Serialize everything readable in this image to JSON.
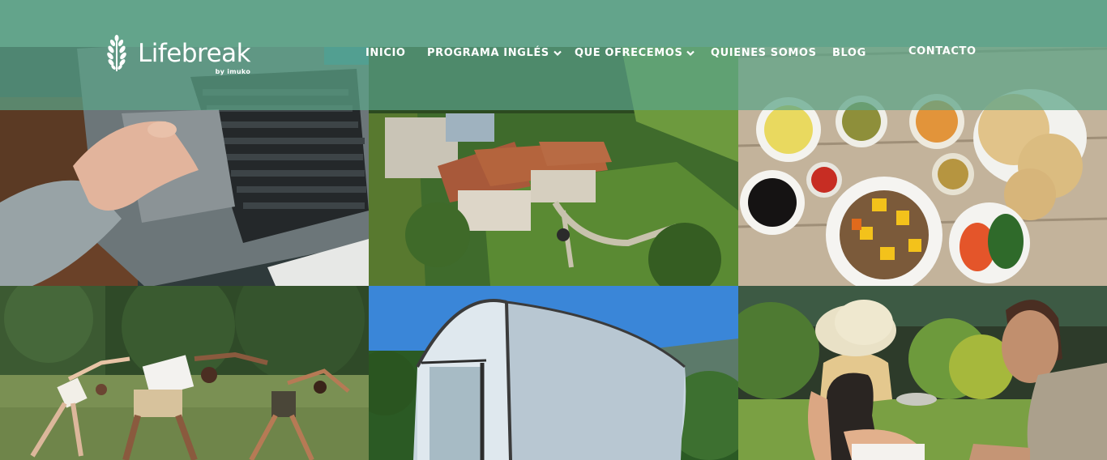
{
  "header": {
    "logo": {
      "word": "Lifebreak",
      "sub": "by imuko"
    },
    "nav": [
      {
        "label": "INICIO",
        "dropdown": false
      },
      {
        "label": "PROGRAMA INGLÉS",
        "dropdown": true
      },
      {
        "label": "QUE OFRECEMOS",
        "dropdown": true
      },
      {
        "label": "QUIENES SOMOS",
        "dropdown": false
      },
      {
        "label": "BLOG",
        "dropdown": false
      },
      {
        "label": "CONTACTO",
        "dropdown": false
      }
    ]
  },
  "colors": {
    "header_bar": "#63a48b",
    "header_band_overlay": "#5ba388",
    "nav_text": "#ffffff"
  },
  "gallery": {
    "tiles": [
      {
        "name": "laptop-photo"
      },
      {
        "name": "house-aerial-photo"
      },
      {
        "name": "food-table-photo"
      },
      {
        "name": "yoga-group-photo"
      },
      {
        "name": "greenhouse-photo"
      },
      {
        "name": "couple-reading-photo"
      }
    ]
  }
}
